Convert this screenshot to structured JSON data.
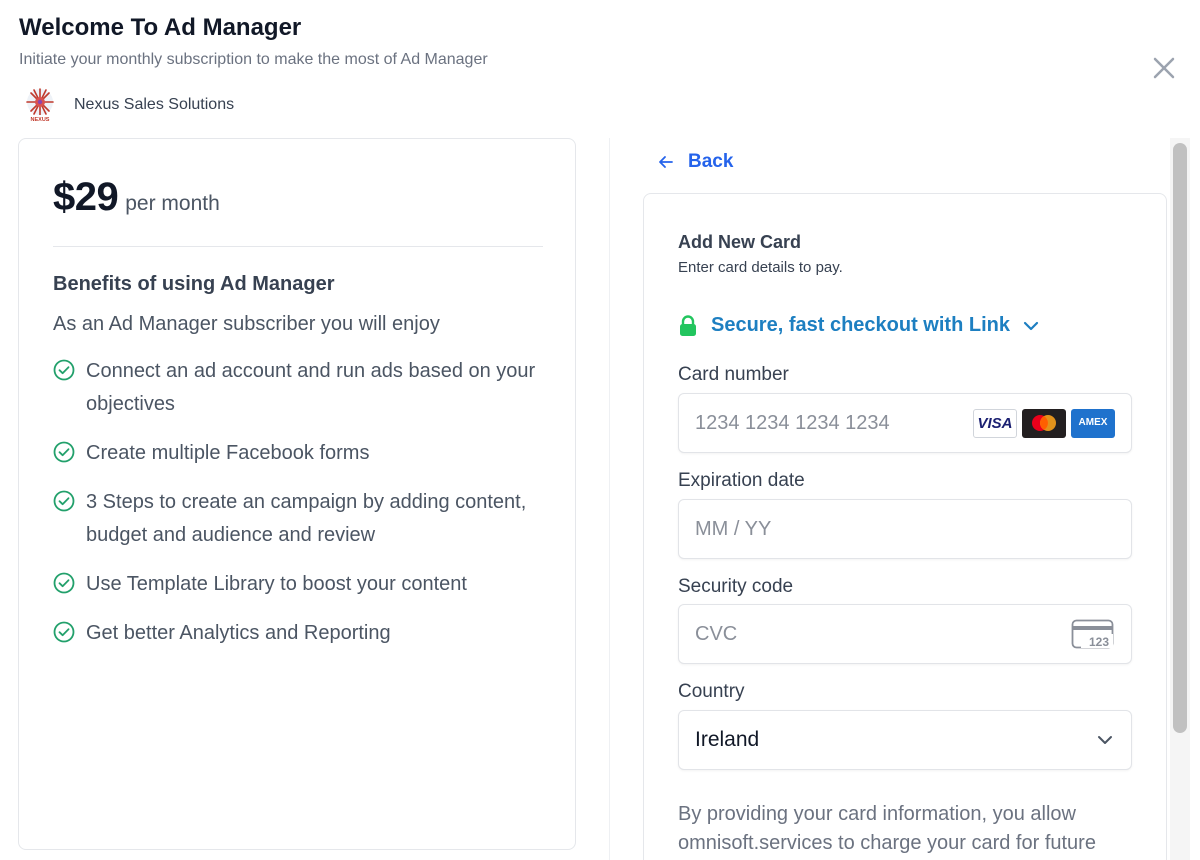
{
  "header": {
    "title": "Welcome To Ad Manager",
    "subtitle": "Initiate your monthly subscription to make the most of Ad Manager",
    "org_name": "Nexus Sales Solutions",
    "org_logo_text": "NEXUS"
  },
  "plan": {
    "price": "$29",
    "period": "per month",
    "benefits_title": "Benefits of using Ad Manager",
    "benefits_subtitle": "As an Ad Manager subscriber you will enjoy",
    "benefits": [
      "Connect an ad account and run ads based on your objectives",
      "Create multiple Facebook forms",
      "3 Steps to create an campaign by adding content, budget and audience and review",
      "Use Template Library to boost your content",
      "Get better Analytics and Reporting"
    ]
  },
  "payment": {
    "back_label": "Back",
    "card_title": "Add New Card",
    "card_subtitle": "Enter card details to pay.",
    "link_text": "Secure, fast checkout with Link",
    "card_number_label": "Card number",
    "card_number_placeholder": "1234 1234 1234 1234",
    "card_brands": [
      "VISA",
      "mastercard",
      "AMEX"
    ],
    "expiration_label": "Expiration date",
    "expiration_placeholder": "MM / YY",
    "security_label": "Security code",
    "security_placeholder": "CVC",
    "cvc_icon_text": "123",
    "country_label": "Country",
    "country_value": "Ireland",
    "disclaimer": "By providing your card information, you allow omnisoft.services to charge your card for future"
  },
  "icons": {
    "close": "close-icon",
    "check": "check-circle-icon",
    "back": "arrow-left-icon",
    "lock": "lock-icon",
    "chevron": "chevron-down-icon",
    "cvc": "card-cvc-icon"
  },
  "colors": {
    "accent_blue": "#2563eb",
    "link_blue": "#1d7fc1",
    "check_green": "#22a06b",
    "lock_green": "#22c55e"
  }
}
